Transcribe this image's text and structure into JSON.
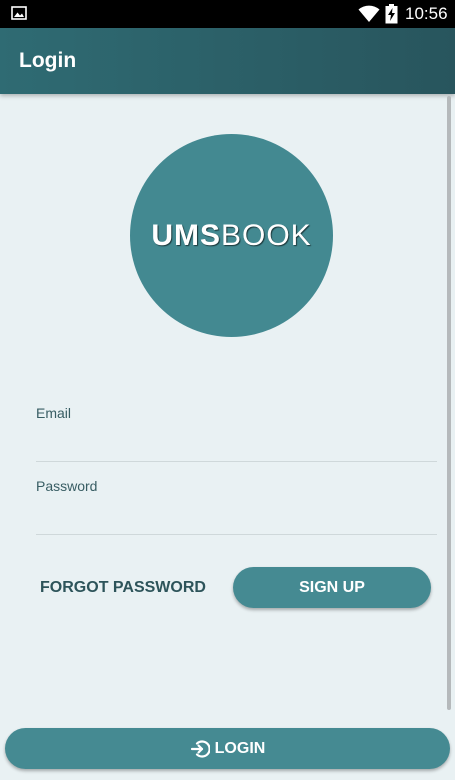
{
  "status_bar": {
    "time": "10:56",
    "icons": [
      "gallery-icon",
      "wifi-icon",
      "battery-charging-icon"
    ]
  },
  "app_bar": {
    "title": "Login"
  },
  "logo": {
    "text_bold": "UMS",
    "text_light": "BOOK",
    "background_color": "#438991"
  },
  "form": {
    "email_label": "Email",
    "email_value": "",
    "password_label": "Password",
    "password_value": ""
  },
  "actions": {
    "forgot_password_label": "FORGOT PASSWORD",
    "sign_up_label": "SIGN UP",
    "login_label": "LOGIN",
    "login_icon": "login-arrow-icon"
  },
  "colors": {
    "primary": "#458a92",
    "app_bar": "#2f6b73",
    "background": "#e9f1f3",
    "text_dark": "#2d545a"
  }
}
